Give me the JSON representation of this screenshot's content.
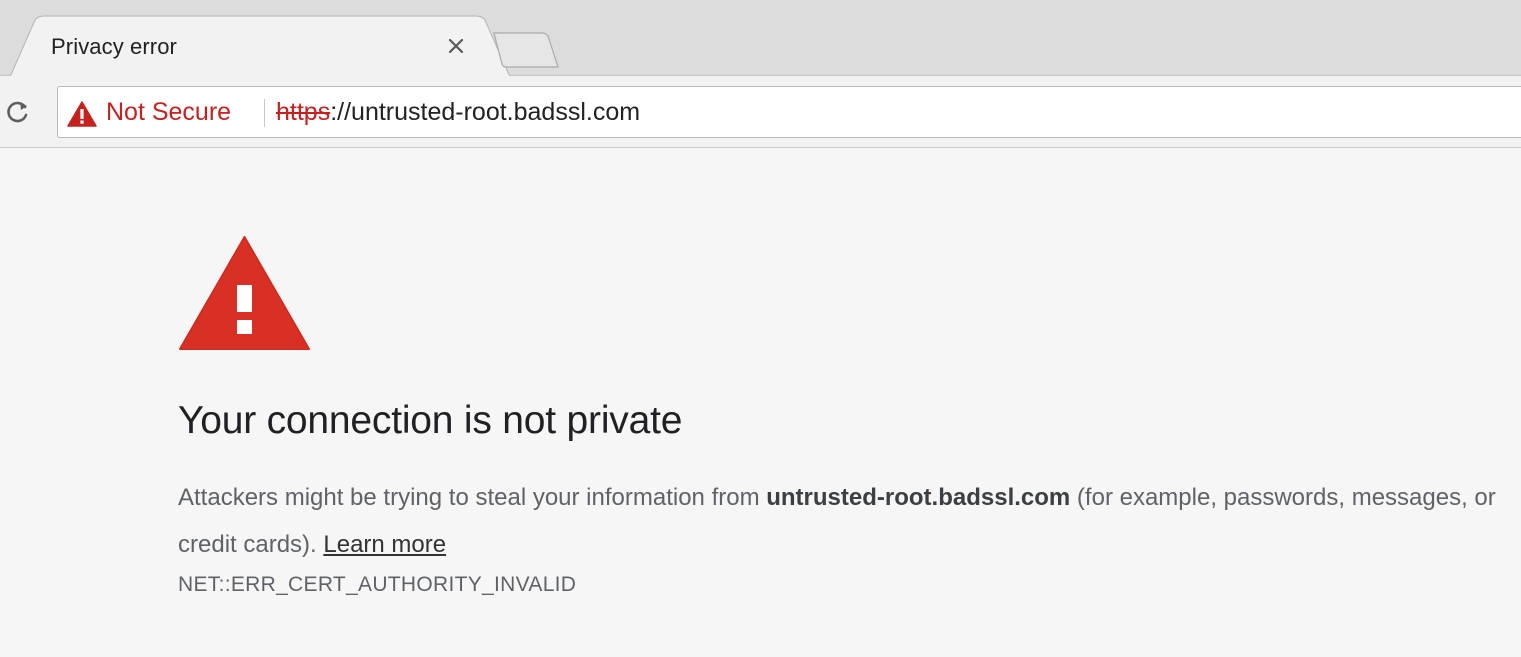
{
  "tab": {
    "title": "Privacy error",
    "close_glyph": "×"
  },
  "toolbar": {
    "security_chip": "Not Secure",
    "url_scheme": "https",
    "url_rest": "://untrusted-root.badssl.com"
  },
  "content": {
    "heading": "Your connection is not private",
    "paragraph_before": "Attackers might be trying to steal your information from ",
    "paragraph_domain": "untrusted-root.badssl.com",
    "paragraph_after": " (for example, passwords, messages, or credit cards). ",
    "learn_more": "Learn more",
    "error_code": "NET::ERR_CERT_AUTHORITY_INVALID"
  },
  "icons": {
    "reload": "reload-icon",
    "warning_small": "warning-triangle-icon",
    "warning_large": "warning-triangle-icon",
    "close": "close-icon"
  },
  "colors": {
    "warning_red": "#d93025",
    "not_secure_red": "#c5221f",
    "page_background": "#f6f6f6",
    "heading_text": "#202124",
    "body_text": "#5f6368"
  }
}
